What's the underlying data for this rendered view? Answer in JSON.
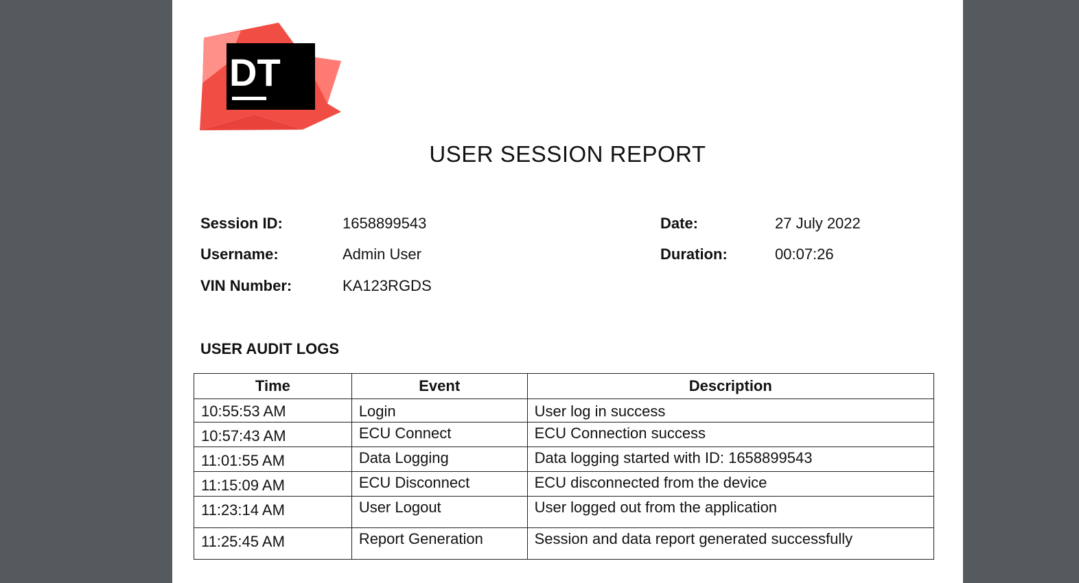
{
  "logo": {
    "text": "DT",
    "colors": {
      "primary": "#f04e45",
      "light": "#ff8f89",
      "dark": "#000000"
    }
  },
  "report": {
    "title": "USER SESSION REPORT"
  },
  "session_info": {
    "session_id_label": "Session ID:",
    "session_id": "1658899543",
    "username_label": "Username:",
    "username": "Admin User",
    "vin_label": "VIN Number:",
    "vin": "KA123RGDS",
    "date_label": "Date:",
    "date": "27 July 2022",
    "duration_label": "Duration:",
    "duration": "00:07:26"
  },
  "audit_logs": {
    "heading": "USER AUDIT LOGS",
    "columns": [
      "Time",
      "Event",
      "Description"
    ],
    "rows": [
      {
        "time": "10:55:53 AM",
        "event": "Login",
        "description": "User log in success"
      },
      {
        "time": "10:57:43 AM",
        "event": "ECU Connect",
        "description": "ECU Connection success"
      },
      {
        "time": "11:01:55 AM",
        "event": "Data Logging",
        "description": "Data logging started with ID: 1658899543"
      },
      {
        "time": "11:15:09 AM",
        "event": "ECU Disconnect",
        "description": "ECU disconnected from the device"
      },
      {
        "time": "11:23:14 AM",
        "event": "User Logout",
        "description": "User logged out from the application"
      },
      {
        "time": "11:25:45 AM",
        "event": "Report Generation",
        "description": "Session and data report generated successfully"
      }
    ]
  }
}
